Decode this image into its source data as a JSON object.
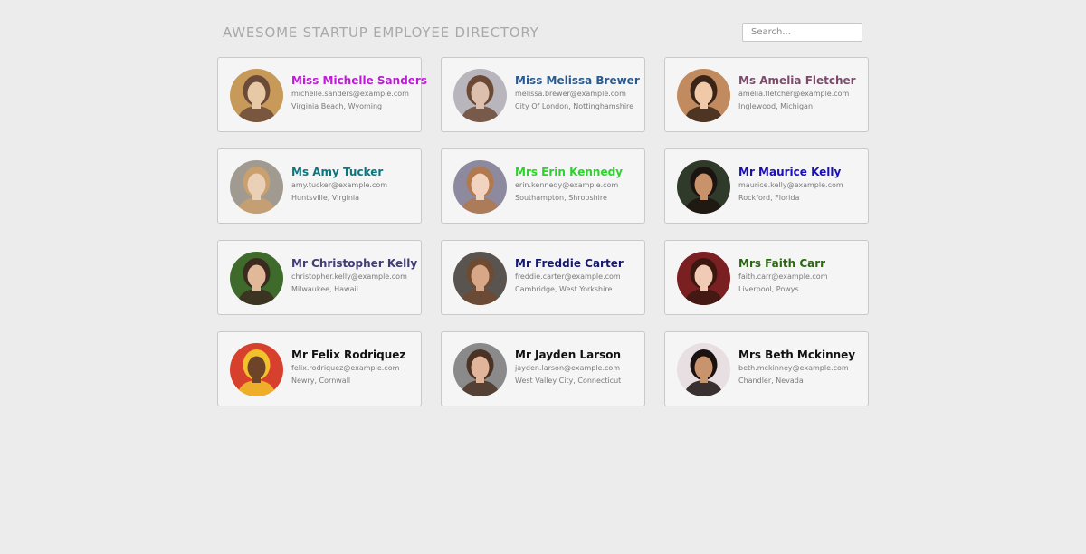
{
  "header": {
    "title": "AWESOME STARTUP EMPLOYEE DIRECTORY",
    "search_placeholder": "Search..."
  },
  "employees": [
    {
      "name": "Miss Michelle Sanders",
      "email": "michelle.sanders@example.com",
      "location": "Virginia Beach, Wyoming",
      "name_color": "#c01ad9",
      "photo_colors": [
        "#c79a5a",
        "#e8c9a5",
        "#6b4a3a"
      ]
    },
    {
      "name": "Miss Melissa Brewer",
      "email": "melissa.brewer@example.com",
      "location": "City Of London, Nottinghamshire",
      "name_color": "#2a5a8e",
      "photo_colors": [
        "#b8b6bc",
        "#dcc0ad",
        "#6b4a35"
      ]
    },
    {
      "name": "Ms Amelia Fletcher",
      "email": "amelia.fletcher@example.com",
      "location": "Inglewood, Michigan",
      "name_color": "#7a4b6a",
      "photo_colors": [
        "#c28a5f",
        "#f0c9a8",
        "#3a2418"
      ]
    },
    {
      "name": "Ms Amy Tucker",
      "email": "amy.tucker@example.com",
      "location": "Huntsville, Virginia",
      "name_color": "#0b7580",
      "photo_colors": [
        "#a09a90",
        "#ead0b6",
        "#c9a06e"
      ]
    },
    {
      "name": "Mrs Erin Kennedy",
      "email": "erin.kennedy@example.com",
      "location": "Southampton, Shropshire",
      "name_color": "#2fd12f",
      "photo_colors": [
        "#8d8aa0",
        "#f2d3c0",
        "#b2784e"
      ]
    },
    {
      "name": "Mr Maurice Kelly",
      "email": "maurice.kelly@example.com",
      "location": "Rockford, Florida",
      "name_color": "#1a0fb8",
      "photo_colors": [
        "#2f3a2a",
        "#c8926a",
        "#1c1410"
      ]
    },
    {
      "name": "Mr Christopher Kelly",
      "email": "christopher.kelly@example.com",
      "location": "Milwaukee, Hawaii",
      "name_color": "#3f3d73",
      "photo_colors": [
        "#3e6a2c",
        "#e1b898",
        "#3a2a20"
      ]
    },
    {
      "name": "Mr Freddie Carter",
      "email": "freddie.carter@example.com",
      "location": "Cambridge, West Yorkshire",
      "name_color": "#161a6e",
      "photo_colors": [
        "#5a5450",
        "#d8a788",
        "#6e4a30"
      ]
    },
    {
      "name": "Mrs Faith Carr",
      "email": "faith.carr@example.com",
      "location": "Liverpool, Powys",
      "name_color": "#2c6613",
      "photo_colors": [
        "#7a1f22",
        "#f1cbb6",
        "#3b1710"
      ]
    },
    {
      "name": "Mr Felix Rodriquez",
      "email": "felix.rodriquez@example.com",
      "location": "Newry, Cornwall",
      "name_color": "#111111",
      "photo_colors": [
        "#d6402c",
        "#6e4429",
        "#f2c22a"
      ]
    },
    {
      "name": "Mr Jayden Larson",
      "email": "jayden.larson@example.com",
      "location": "West Valley City, Connecticut",
      "name_color": "#111111",
      "photo_colors": [
        "#8a8a8a",
        "#e0b59a",
        "#4a3324"
      ]
    },
    {
      "name": "Mrs Beth Mckinney",
      "email": "beth.mckinney@example.com",
      "location": "Chandler, Nevada",
      "name_color": "#111111",
      "photo_colors": [
        "#e7dfe2",
        "#c8946e",
        "#1a1210"
      ]
    }
  ]
}
